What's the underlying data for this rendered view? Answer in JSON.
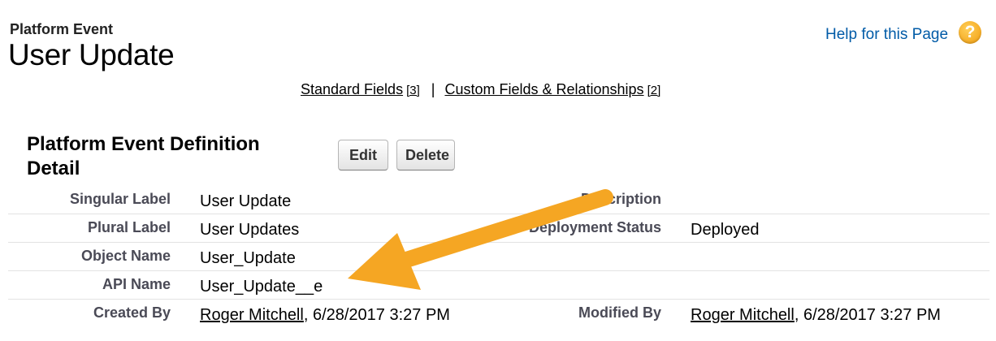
{
  "header": {
    "object_type": "Platform Event",
    "title": "User Update",
    "help_link": "Help for this Page",
    "help_icon": "question-mark-icon"
  },
  "related_nav": {
    "standard_fields": {
      "label": "Standard Fields",
      "count": "[3]"
    },
    "separator": "|",
    "custom_fields": {
      "label": "Custom Fields & Relationships",
      "count": "[2]"
    }
  },
  "section": {
    "title": "Platform Event Definition Detail",
    "edit_label": "Edit",
    "delete_label": "Delete"
  },
  "details": {
    "singular_label": {
      "label": "Singular Label",
      "value": "User Update"
    },
    "description": {
      "label": "Description",
      "value": ""
    },
    "plural_label": {
      "label": "Plural Label",
      "value": "User Updates"
    },
    "deployment_status": {
      "label": "Deployment Status",
      "value": "Deployed"
    },
    "object_name": {
      "label": "Object Name",
      "value": "User_Update"
    },
    "api_name": {
      "label": "API Name",
      "value": "User_Update__e"
    },
    "created_by": {
      "label": "Created By",
      "user": "Roger Mitchell",
      "date": ", 6/28/2017 3:27 PM"
    },
    "modified_by": {
      "label": "Modified By",
      "user": "Roger Mitchell",
      "date": ", 6/28/2017 3:27 PM"
    }
  },
  "annotation": {
    "arrow_color": "#f5a623",
    "arrow_icon": "orange-arrow-annotation"
  }
}
